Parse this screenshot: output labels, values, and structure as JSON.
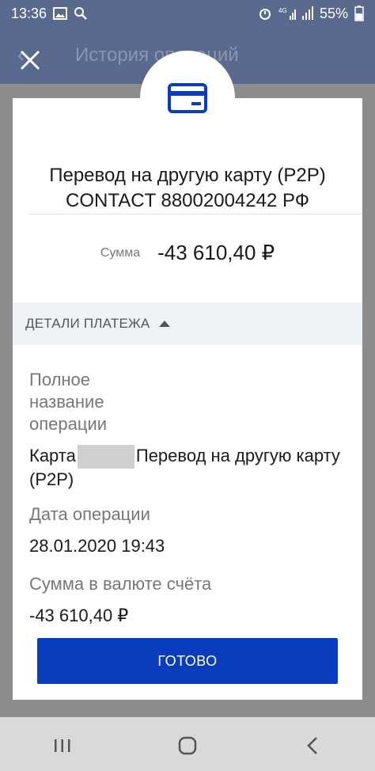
{
  "status_bar": {
    "time": "13:36",
    "battery": "55%",
    "icons": [
      "image-icon",
      "search-icon",
      "alarm-icon",
      "signal-4g-icon",
      "signal-icon",
      "battery-icon"
    ]
  },
  "app_header": {
    "title": "История операций"
  },
  "dialog": {
    "title_line1": "Перевод на другую карту (P2P)",
    "title_line2": "CONTACT 88002004242 РФ",
    "amount_label": "Сумма",
    "amount_value": "-43 610,40 ₽",
    "details_header": "ДЕТАЛИ ПЛАТЕЖА",
    "fields": {
      "full_name_label": "Полное название операции",
      "full_name_prefix": "Карта",
      "full_name_suffix": "Перевод на другую карту (P2P)",
      "date_label": "Дата операции",
      "date_value": "28.01.2020 19:43",
      "account_sum_label": "Сумма в валюте счёта",
      "account_sum_value": "-43 610,40 ₽"
    },
    "done_button": "ГОТОВО"
  },
  "colors": {
    "primary": "#0a3dbd",
    "statusbar": "#5a6a8e",
    "details_bg": "#eef3f8"
  }
}
